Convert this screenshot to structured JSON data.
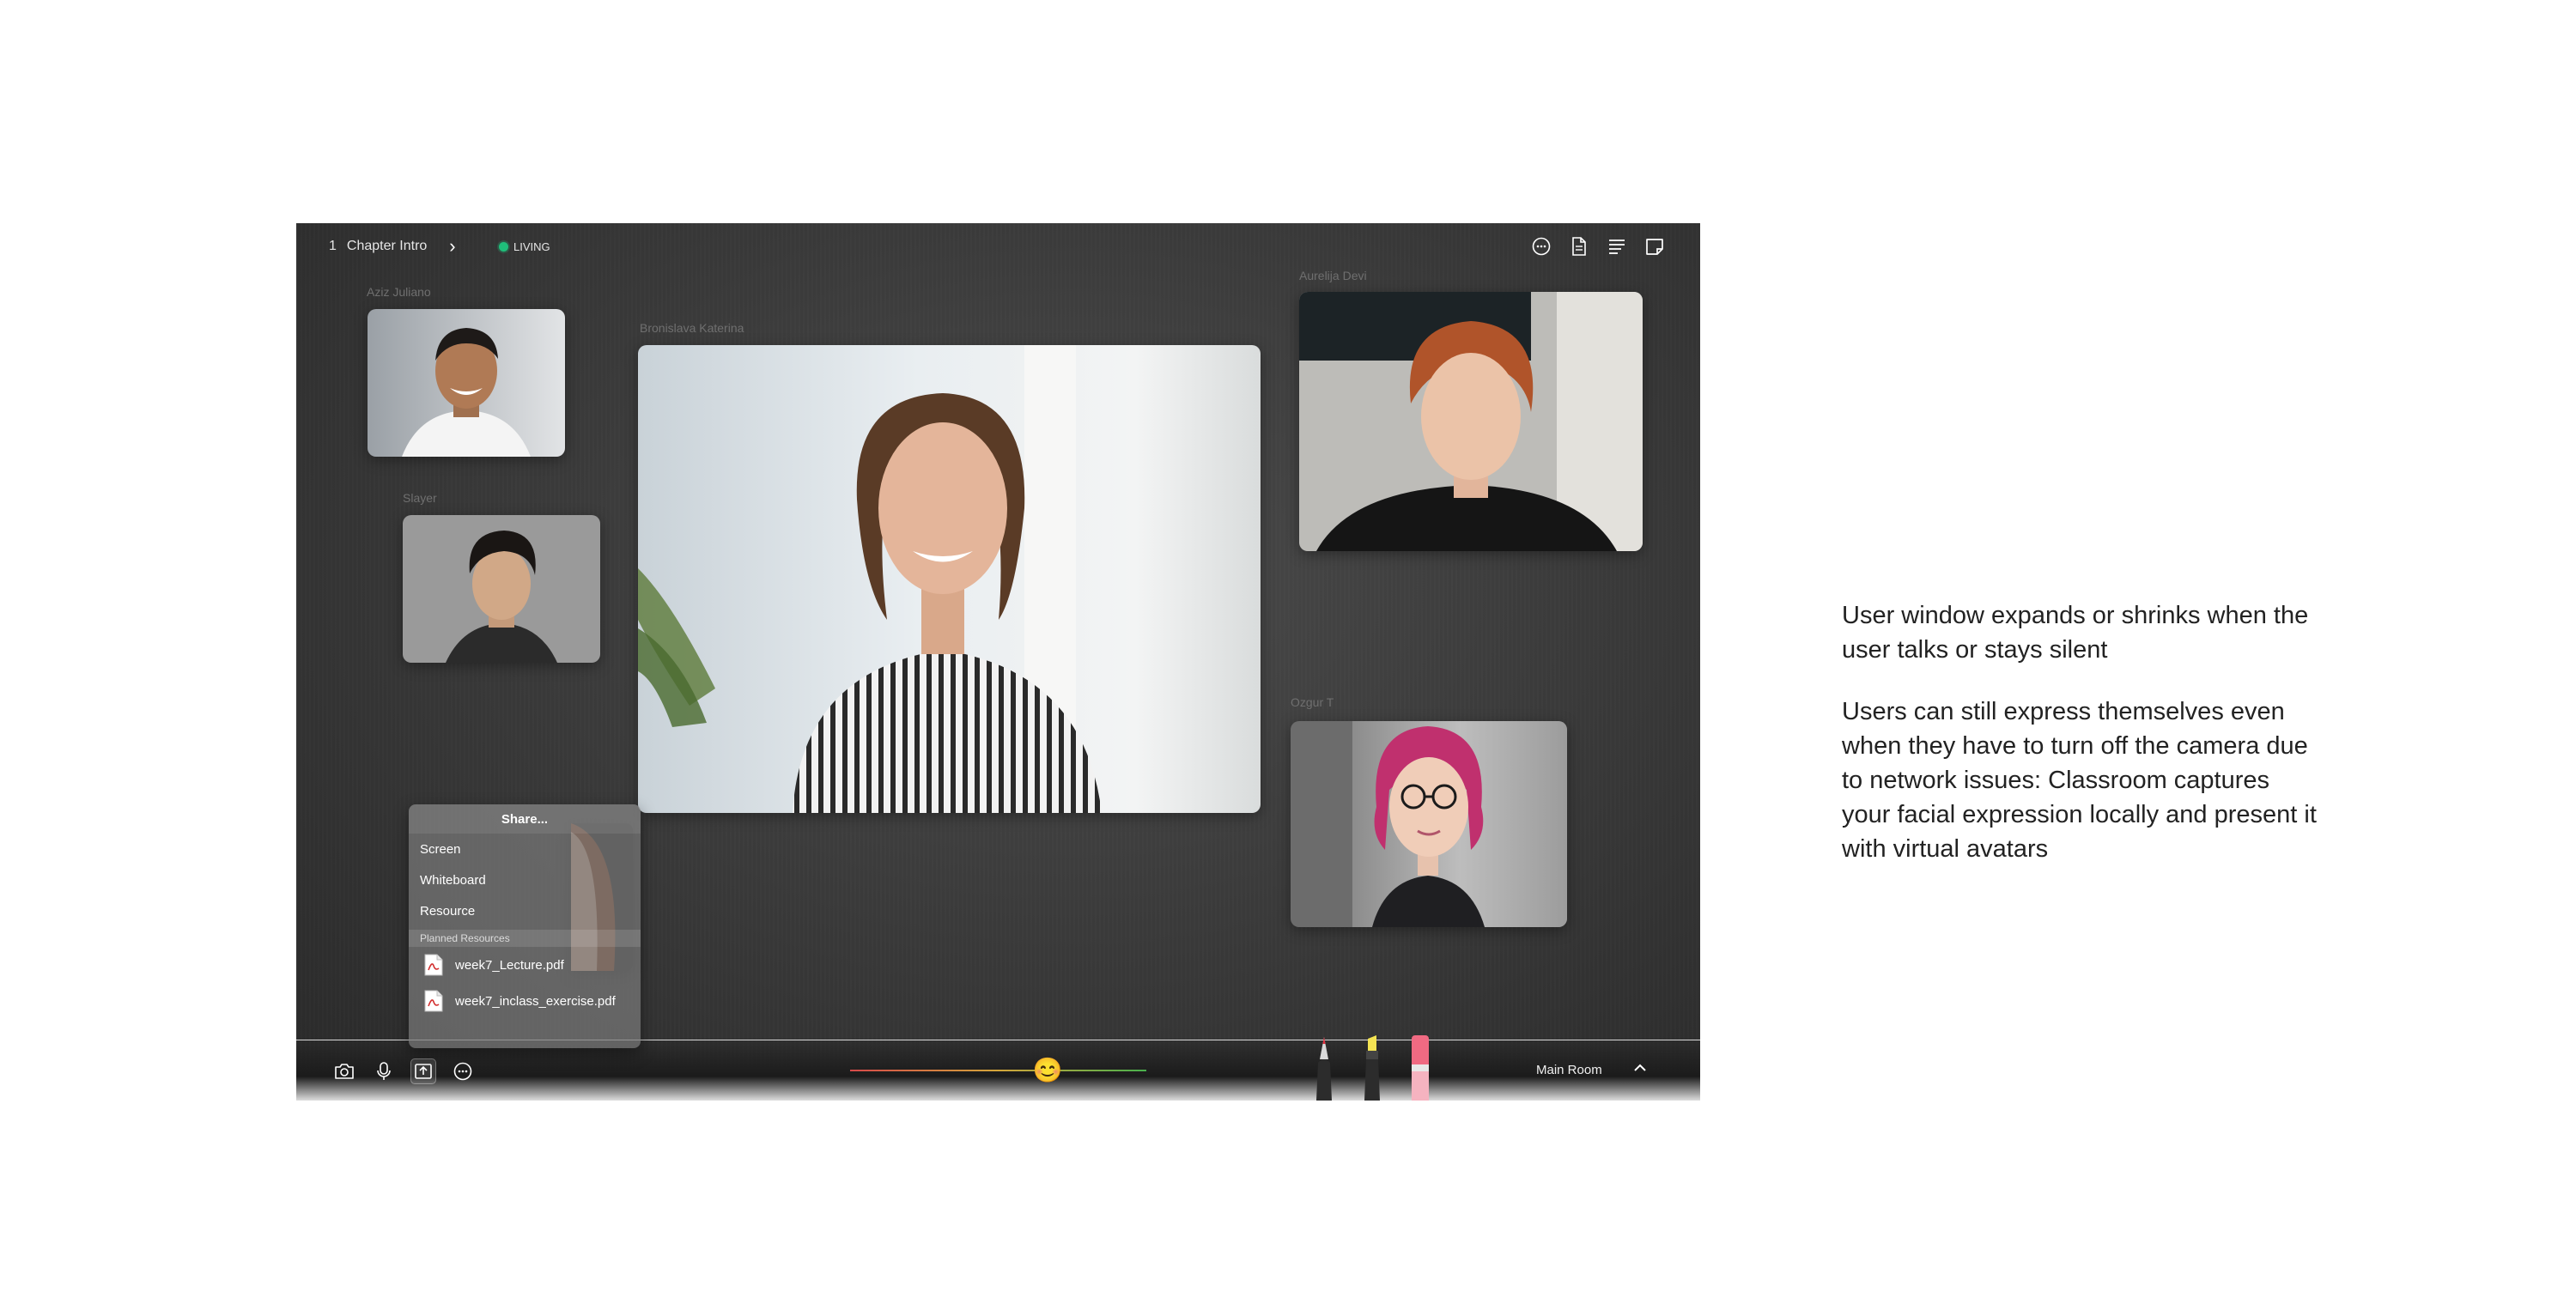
{
  "topbar": {
    "chapter_number": "1",
    "chapter_title": "Chapter Intro",
    "status": "LIVING",
    "icons": [
      "chat-bubble-icon",
      "document-icon",
      "list-icon",
      "sticky-note-icon"
    ]
  },
  "participants": [
    {
      "name": "Aziz Juliano"
    },
    {
      "name": "Slayer"
    },
    {
      "name": "Bronislava Katerina"
    },
    {
      "name": "Aurelija Devi"
    },
    {
      "name": "Ozgur T"
    }
  ],
  "share_menu": {
    "title": "Share...",
    "items": [
      "Screen",
      "Whiteboard",
      "Resource"
    ],
    "section_label": "Planned Resources",
    "files": [
      "week7_Lecture.pdf",
      "week7_inclass_exercise.pdf"
    ]
  },
  "bottombar": {
    "icons": [
      "camera-icon",
      "microphone-icon",
      "share-icon",
      "more-icon"
    ],
    "mood_emoji": "😊",
    "mood_level": 0.66,
    "pens": [
      "red-pen-icon",
      "yellow-highlighter-icon",
      "pink-eraser-icon"
    ],
    "room_label": "Main Room"
  },
  "description": {
    "para1": "User window expands or shrinks when the user talks or stays silent",
    "para2": "Users can still express themselves even when they have to turn off the camera due to network issues: Classroom captures your facial expression locally and present it with virtual avatars"
  },
  "colors": {
    "live_dot": "#1fbf7a",
    "mood_red": "#d64a4a",
    "mood_green": "#48b04c"
  }
}
